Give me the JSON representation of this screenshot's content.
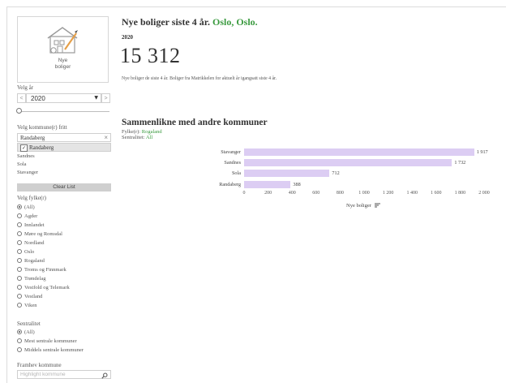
{
  "logo": {
    "line1": "Nye",
    "line2": "boliger"
  },
  "year_filter": {
    "label": "Velg år",
    "value": "2020",
    "prev": "<",
    "next": ">"
  },
  "municipality_filter": {
    "label": "Velg kommune(r) fritt",
    "search_value": "Randaberg",
    "clear_x": "×",
    "selected": "Randaberg",
    "items": [
      "Sandnes",
      "Sola",
      "Stavanger"
    ],
    "clear_button": "Clear List"
  },
  "county_filter": {
    "label": "Velg fylke(r)",
    "options": [
      "(All)",
      "Agder",
      "Innlandet",
      "Møre og Romsdal",
      "Nordland",
      "Oslo",
      "Rogaland",
      "Troms og Finnmark",
      "Trøndelag",
      "Vestfold og Telemark",
      "Vestland",
      "Viken"
    ]
  },
  "centrality_filter": {
    "label": "Sentralitet",
    "options": [
      "(All)",
      "Mest sentrale kommuner",
      "Middels sentrale kommuner"
    ]
  },
  "highlight": {
    "label": "Framhev kommune",
    "placeholder": "Highlight kommune"
  },
  "header": {
    "title_prefix": "Nye boliger siste 4 år.",
    "title_place": "Oslo, Oslo.",
    "year": "2020",
    "big_number": "15 312",
    "description": "Nye boliger de siste 4 år. Boliger fra Matrikkelen for aktuelt år igangsatt siste 4 år."
  },
  "compare": {
    "title": "Sammenlikne med andre kommuner",
    "fylke_label": "Fylke(r):",
    "fylke_value": "Rogaland",
    "sentralitet_label": "Sentralitet:",
    "sentralitet_value": "All"
  },
  "colors": {
    "accent_green": "#3a9a3f",
    "bar": "#dccdf3"
  },
  "chart_data": {
    "type": "bar",
    "orientation": "horizontal",
    "categories": [
      "Stavanger",
      "Sandnes",
      "Sola",
      "Randaberg"
    ],
    "values": [
      1917,
      1732,
      712,
      388
    ],
    "value_labels": [
      "1 917",
      "1 732",
      "712",
      "388"
    ],
    "xticks": [
      0,
      200,
      400,
      600,
      800,
      1000,
      1200,
      1400,
      1600,
      1800,
      2000
    ],
    "xtick_labels": [
      "0",
      "200",
      "400",
      "600",
      "800",
      "1 000",
      "1 200",
      "1 400",
      "1 600",
      "1 800",
      "2 000"
    ],
    "xlim": [
      0,
      2000
    ],
    "xlabel": "Nye boliger"
  }
}
